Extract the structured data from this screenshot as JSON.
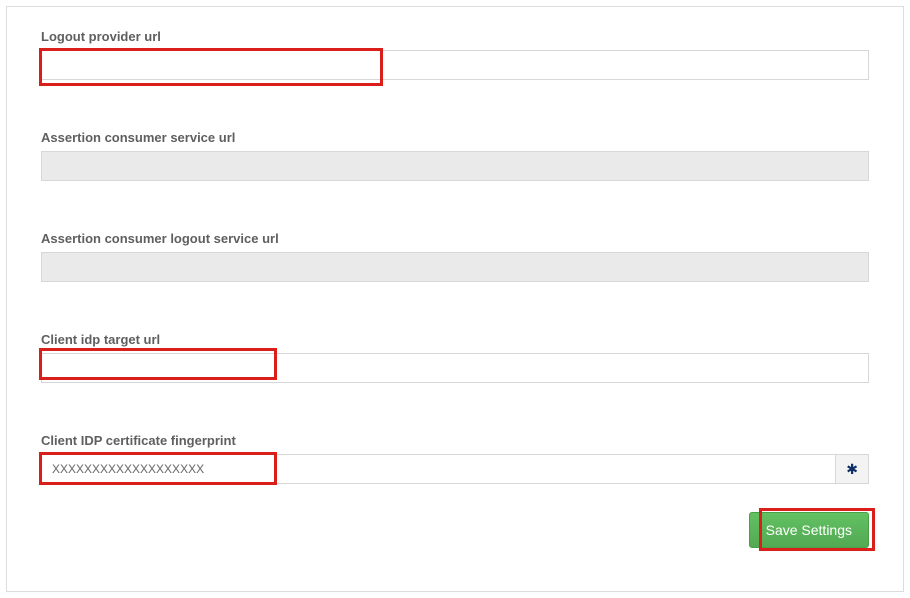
{
  "fields": {
    "logout_provider_url": {
      "label": "Logout provider url",
      "value": ""
    },
    "assertion_consumer_service_url": {
      "label": "Assertion consumer service url",
      "value": ""
    },
    "assertion_consumer_logout_service_url": {
      "label": "Assertion consumer logout service url",
      "value": ""
    },
    "client_idp_target_url": {
      "label": "Client idp target url",
      "value": ""
    },
    "client_idp_certificate_fingerprint": {
      "label": "Client IDP certificate fingerprint",
      "value": "XXXXXXXXXXXXXXXXXXX"
    }
  },
  "buttons": {
    "save_settings": "Save Settings"
  },
  "icons": {
    "certificate": "✱"
  }
}
